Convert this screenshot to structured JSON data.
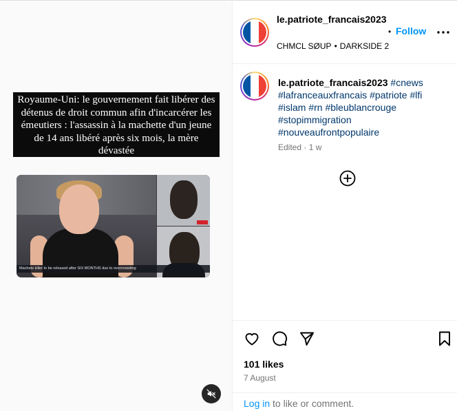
{
  "media": {
    "headline": "Royaume-Uni: le gouvernement fait libérer des détenus de droit commun afin d'incarcérer les émeutiers : l'assassin à la machette d'un jeune de 14 ans libéré après six mois, la mère dévastée",
    "photo_caption": "Machete killer to be released after SIX MONTHS due to overcrowding",
    "mute_icon": "speaker-muted-icon"
  },
  "header": {
    "username": "le.patriote_francais2023",
    "dot": "•",
    "follow_label": "Follow",
    "audio_artist": "CHMCL SØUP",
    "audio_sep": "•",
    "audio_track": "DARKSIDE 2",
    "more_icon": "more-horizontal-icon"
  },
  "caption": {
    "username": "le.patriote_francais2023",
    "hashtags": [
      "#cnews",
      "#lafranceauxfrancais",
      "#patriote",
      "#lfi",
      "#islam",
      "#rn",
      "#bleublancrouge",
      "#stopimmigration",
      "#nouveaufrontpopulaire"
    ],
    "edited": "Edited",
    "age": "1 w",
    "meta_sep": "·"
  },
  "actions": {
    "like_icon": "heart-icon",
    "comment_icon": "comment-icon",
    "share_icon": "send-icon",
    "save_icon": "bookmark-icon"
  },
  "stats": {
    "likes": "101 likes",
    "date": "7 August"
  },
  "footer": {
    "login_label": "Log in",
    "login_rest": " to like or comment."
  },
  "colors": {
    "link_blue": "#0095f6",
    "hashtag": "#00376b",
    "muted_text": "#737373",
    "flag_blue": "#0055a4",
    "flag_red": "#ef4135"
  }
}
